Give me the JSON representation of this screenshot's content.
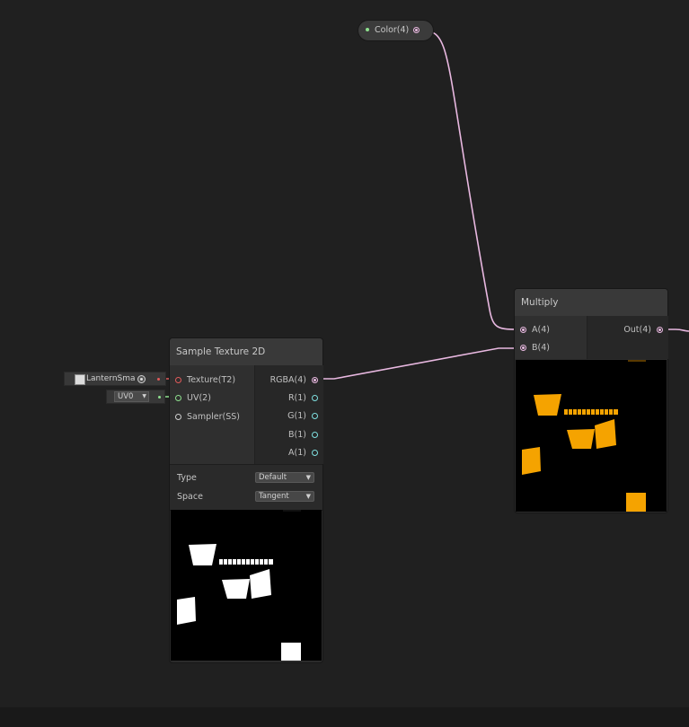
{
  "color_node": {
    "label": "Color(4)"
  },
  "sample_texture": {
    "title": "Sample Texture 2D",
    "inputs": [
      "Texture(T2)",
      "UV(2)",
      "Sampler(SS)"
    ],
    "outputs": [
      "RGBA(4)",
      "R(1)",
      "G(1)",
      "B(1)",
      "A(1)"
    ],
    "properties": [
      {
        "label": "Type",
        "value": "Default"
      },
      {
        "label": "Space",
        "value": "Tangent"
      }
    ],
    "texture_field": "LanternSma",
    "uv_field": "UV0"
  },
  "multiply": {
    "title": "Multiply",
    "inputs": [
      "A(4)",
      "B(4)"
    ],
    "outputs": [
      "Out(4)"
    ]
  },
  "colors": {
    "background": "#202020",
    "wire_color": "#e8b8e0",
    "texture_port": "#e05a5a",
    "uv_port": "#8ee08e",
    "float_port": "#7fe0e0",
    "vector4_port": "#e8b8e0",
    "preview_tint": "#f5a300"
  },
  "icons": [
    "texture-thumbnail-icon",
    "object-picker-icon",
    "chevron-down-icon"
  ]
}
